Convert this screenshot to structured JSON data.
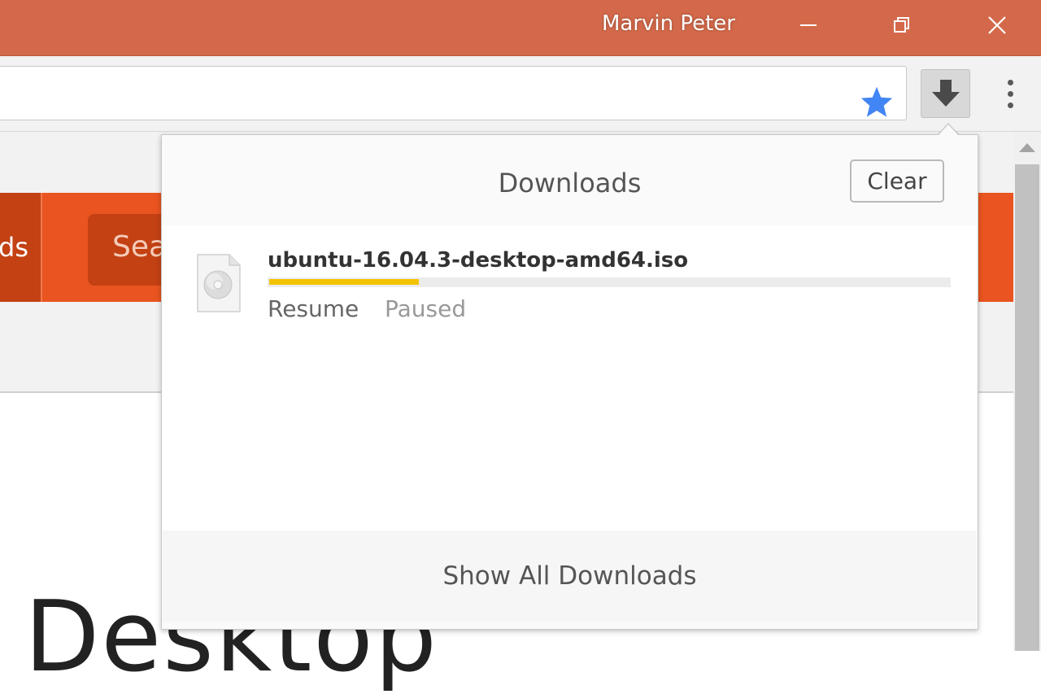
{
  "window": {
    "profile_name": "Marvin Peter",
    "minimize_icon": "minimize-icon",
    "restore_icon": "restore-icon",
    "close_icon": "close-icon",
    "frame_color": "#d3694a"
  },
  "toolbar": {
    "address_text": "",
    "bookmark_icon": "star-icon",
    "bookmark_color": "#4285f4",
    "downloads_icon": "download-arrow-icon",
    "menu_icon": "more-vert-icon"
  },
  "page": {
    "nav_partial_text": "ds",
    "search_partial_text": "Sea",
    "heading_partial_text": "Desktop",
    "nav_color": "#e95420"
  },
  "downloads": {
    "title": "Downloads",
    "clear_label": "Clear",
    "items": [
      {
        "file_name": "ubuntu-16.04.3-desktop-amd64.iso",
        "icon": "disc-file-icon",
        "progress_percent": 22,
        "action_label": "Resume",
        "status": "Paused",
        "progress_color": "#f3c200"
      }
    ],
    "show_all_label": "Show All Downloads"
  }
}
